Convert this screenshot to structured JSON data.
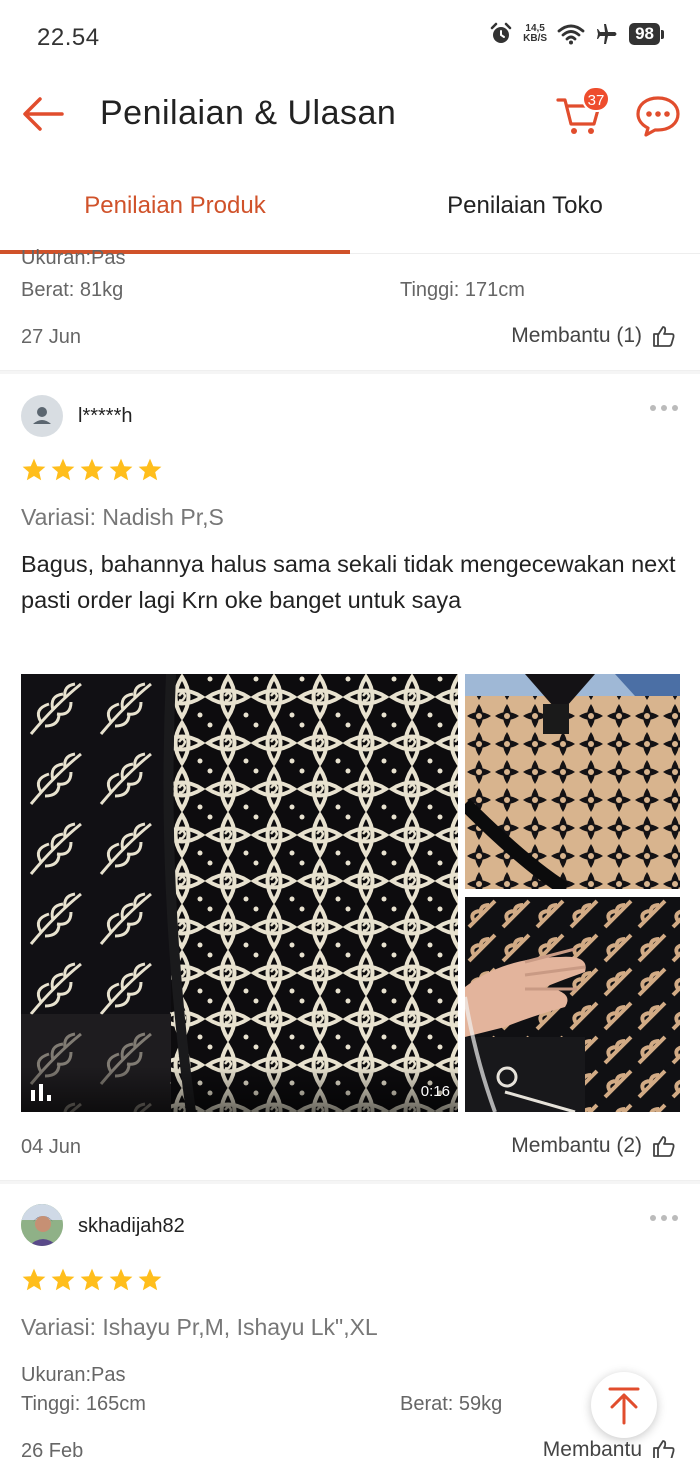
{
  "status_bar": {
    "time": "22.54",
    "net_speed_value": "14,5",
    "net_speed_unit": "KB/S",
    "battery": "98",
    "icons": [
      "alarm-icon",
      "wifi-icon",
      "airplane-icon",
      "battery-icon"
    ]
  },
  "header": {
    "title": "Penilaian & Ulasan",
    "cart_count": "37",
    "accent_color": "#ee4d2d"
  },
  "tabs": [
    {
      "label": "Penilaian Produk",
      "active": true
    },
    {
      "label": "Penilaian Toko",
      "active": false
    }
  ],
  "previous_review": {
    "size_fit": "Ukuran:Pas",
    "weight": "Berat: 81kg",
    "height": "Tinggi: 171cm",
    "date": "27 Jun",
    "helpful": "Membantu (1)"
  },
  "review1": {
    "username": "l*****h",
    "rating": 5,
    "variant": "Variasi: Nadish Pr,S",
    "text": "Bagus, bahannya halus sama sekali tidak mengecewakan next pasti order lagi Krn oke banget untuk saya",
    "video_duration": "0:16",
    "date": "04 Jun",
    "helpful": "Membantu (2)"
  },
  "review2": {
    "username": "skhadijah82",
    "rating": 5,
    "variant": "Variasi: Ishayu Pr,M, Ishayu Lk\",XL",
    "size_fit": "Ukuran:Pas",
    "height": "Tinggi: 165cm",
    "weight": "Berat: 59kg",
    "date": "26 Feb",
    "helpful": "Membantu"
  }
}
